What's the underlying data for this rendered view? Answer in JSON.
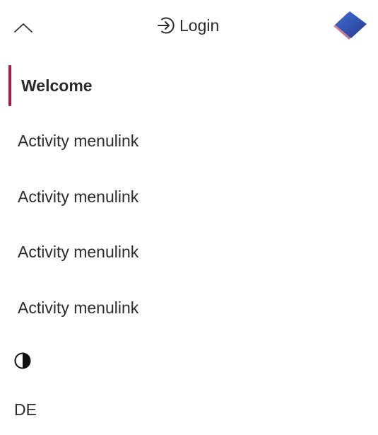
{
  "header": {
    "collapse_icon": "chevron-up-icon",
    "login_label": "Login",
    "login_icon": "login-arrow-icon",
    "logo_icon": "diamond-logo-icon"
  },
  "nav": {
    "items": [
      {
        "label": "Welcome",
        "active": true
      },
      {
        "label": "Activity menulink",
        "active": false
      },
      {
        "label": "Activity menulink",
        "active": false
      },
      {
        "label": "Activity menulink",
        "active": false
      },
      {
        "label": "Activity menulink",
        "active": false
      }
    ]
  },
  "footer": {
    "theme_icon": "contrast-icon",
    "language_label": "DE"
  },
  "colors": {
    "accent": "#a8194e",
    "text": "#2b2b2b",
    "background": "#ffffff"
  }
}
